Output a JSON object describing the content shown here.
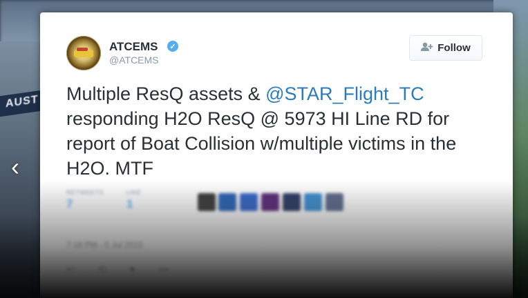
{
  "background": {
    "sign_text": "AUST",
    "prev_arrow": "‹"
  },
  "tweet": {
    "display_name": "ATCEMS",
    "handle": "@ATCEMS",
    "verified_glyph": "✓",
    "follow_label": "Follow",
    "follow_icon_glyph": "👤",
    "text_part1": "Multiple ResQ assets & ",
    "mention": "@STAR_Flight_TC",
    "text_part2": " responding H2O ResQ @ 5973 HI Line RD for report of Boat Collision w/multiple victims in the H2O. MTF",
    "stats": {
      "retweets_label": "RETWEETS",
      "retweets_value": "7",
      "likes_label": "LIKE",
      "likes_value": "1"
    },
    "date": "7:16 PM - 5 Jul 2015",
    "colors": {
      "accent": "#55acee",
      "link": "#2b7bb9",
      "text": "#292f33",
      "muted": "#8899a6"
    }
  }
}
